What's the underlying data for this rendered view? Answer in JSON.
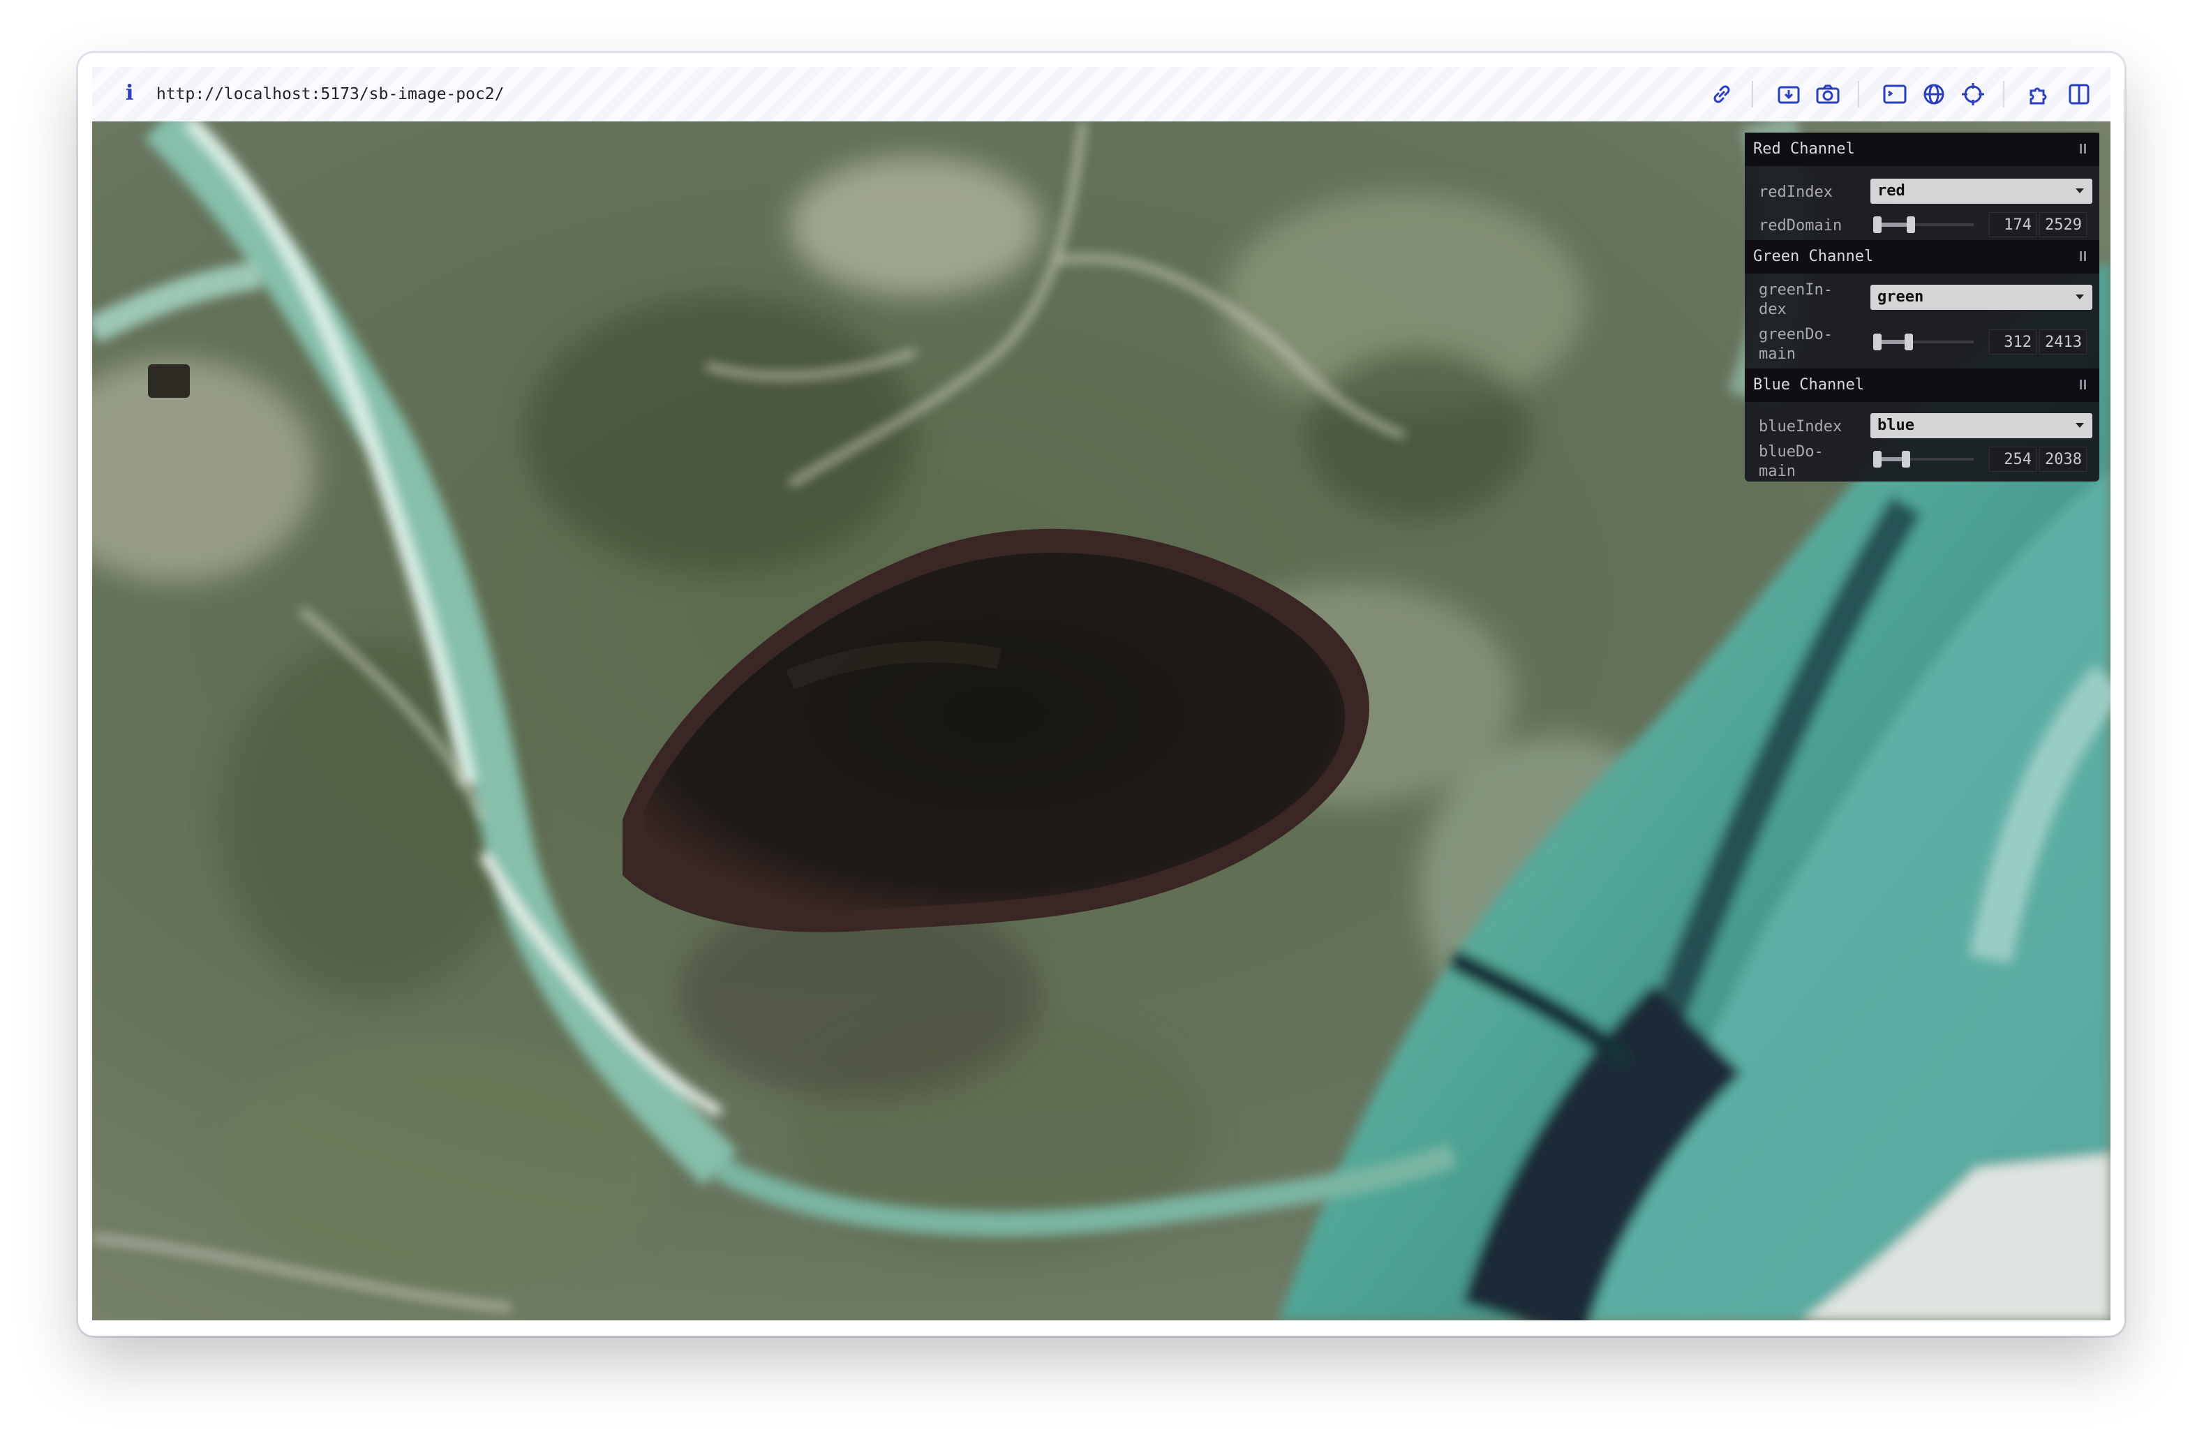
{
  "toolbar": {
    "url": "http://localhost:5173/sb-image-poc2/",
    "icons": [
      "info-icon",
      "link-icon",
      "download-icon",
      "camera-icon",
      "terminal-icon",
      "globe-icon",
      "crosshair-icon",
      "extensions-icon",
      "split-view-icon"
    ]
  },
  "panel": {
    "red": {
      "title": "Red Channel",
      "index_label": "redIndex",
      "index_value": "red",
      "domain_label": "redDomain",
      "domain_min": "174",
      "domain_max": "2529",
      "slider": {
        "lo": 0.0,
        "hi": 0.35
      }
    },
    "green": {
      "title": "Green Channel",
      "index_label": "greenIn-\ndex",
      "index_value": "green",
      "domain_label": "greenDo-\nmain",
      "domain_min": "312",
      "domain_max": "2413",
      "slider": {
        "lo": 0.0,
        "hi": 0.33
      }
    },
    "blue": {
      "title": "Blue Channel",
      "index_label": "blueIndex",
      "index_value": "blue",
      "domain_label": "blueDo-\nmain",
      "domain_min": "254",
      "domain_max": "2038",
      "slider": {
        "lo": 0.0,
        "hi": 0.3
      }
    }
  },
  "colors": {
    "accent": "#2a3fbf",
    "panel_bg": "#18191e",
    "land": "#5e6a58",
    "water": "#5fb0a2",
    "lake": "#1a1713"
  }
}
